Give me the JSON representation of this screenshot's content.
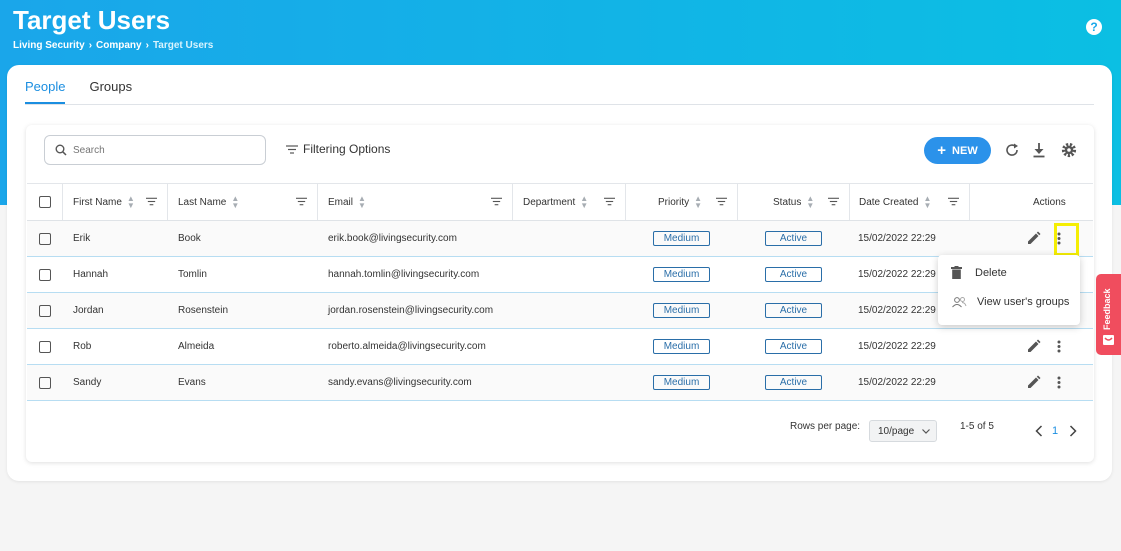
{
  "header": {
    "title": "Target Users",
    "breadcrumb": [
      "Living Security",
      "Company",
      "Target Users"
    ],
    "help_label": "?"
  },
  "tabs": [
    {
      "label": "People",
      "active": true
    },
    {
      "label": "Groups",
      "active": false
    }
  ],
  "toolbar": {
    "search_placeholder": "Search",
    "filtering_label": "Filtering Options",
    "new_label": "NEW"
  },
  "table": {
    "columns": [
      "First Name",
      "Last Name",
      "Email",
      "Department",
      "Priority",
      "Status",
      "Date Created",
      "Actions"
    ],
    "rows": [
      {
        "first": "Erik",
        "last": "Book",
        "email": "erik.book@livingsecurity.com",
        "department": "",
        "priority": "Medium",
        "status": "Active",
        "created": "15/02/2022 22:29"
      },
      {
        "first": "Hannah",
        "last": "Tomlin",
        "email": "hannah.tomlin@livingsecurity.com",
        "department": "",
        "priority": "Medium",
        "status": "Active",
        "created": "15/02/2022 22:29"
      },
      {
        "first": "Jordan",
        "last": "Rosenstein",
        "email": "jordan.rosenstein@livingsecurity.com",
        "department": "",
        "priority": "Medium",
        "status": "Active",
        "created": "15/02/2022 22:29"
      },
      {
        "first": "Rob",
        "last": "Almeida",
        "email": "roberto.almeida@livingsecurity.com",
        "department": "",
        "priority": "Medium",
        "status": "Active",
        "created": "15/02/2022 22:29"
      },
      {
        "first": "Sandy",
        "last": "Evans",
        "email": "sandy.evans@livingsecurity.com",
        "department": "",
        "priority": "Medium",
        "status": "Active",
        "created": "15/02/2022 22:29"
      }
    ]
  },
  "dropdown": {
    "delete_label": "Delete",
    "groups_label": "View user's groups"
  },
  "pagination": {
    "rows_per_page_label": "Rows per page:",
    "page_size": "10/page",
    "range": "1-5 of 5",
    "current_page": "1"
  },
  "feedback_label": "Feedback",
  "colors": {
    "header_start": "#1aa6ea",
    "header_end": "#0bbfe3",
    "accent": "#2b92ea",
    "feedback": "#f04d5e",
    "highlight": "#f5ee04"
  }
}
